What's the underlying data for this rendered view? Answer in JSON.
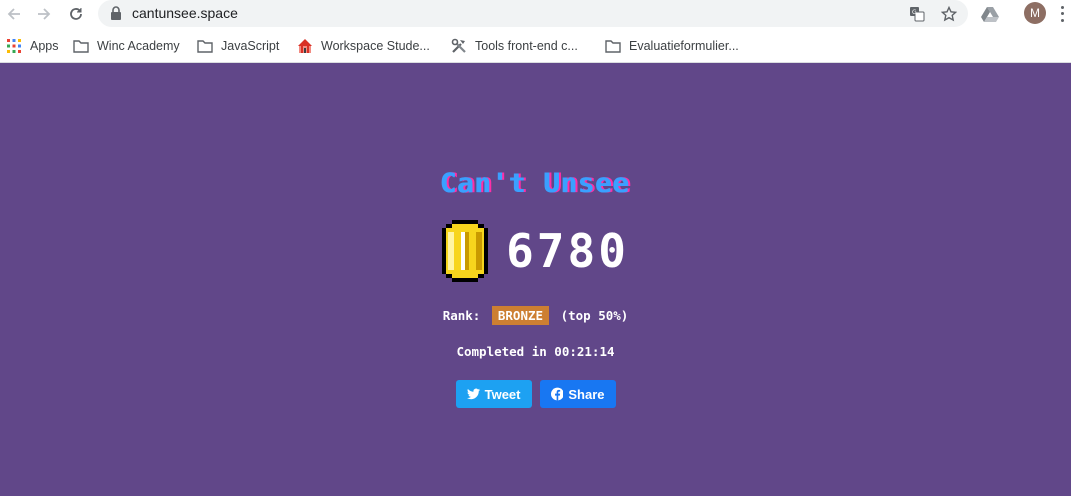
{
  "browser": {
    "url": "cantunsee.space",
    "avatar_initial": "M"
  },
  "bookmarks": [
    {
      "label": "Apps",
      "icon": "apps-grid-icon"
    },
    {
      "label": "Winc Academy",
      "icon": "folder-icon"
    },
    {
      "label": "JavaScript",
      "icon": "folder-icon"
    },
    {
      "label": "Workspace Stude...",
      "icon": "circus-tent-icon"
    },
    {
      "label": "Tools front-end c...",
      "icon": "tools-icon"
    },
    {
      "label": "Evaluatieformulier...",
      "icon": "folder-icon"
    }
  ],
  "game": {
    "title": "Can't Unsee",
    "score": "6780",
    "rank_label": "Rank:",
    "rank_badge": "BRONZE",
    "rank_suffix": "(top 50%)",
    "completed_text": "Completed in 00:21:14"
  },
  "share": {
    "tweet_label": "Tweet",
    "share_label": "Share"
  },
  "colors": {
    "background": "#614789",
    "badge": "#cd7f32",
    "tweet": "#1da1f2",
    "facebook": "#1877f2"
  }
}
